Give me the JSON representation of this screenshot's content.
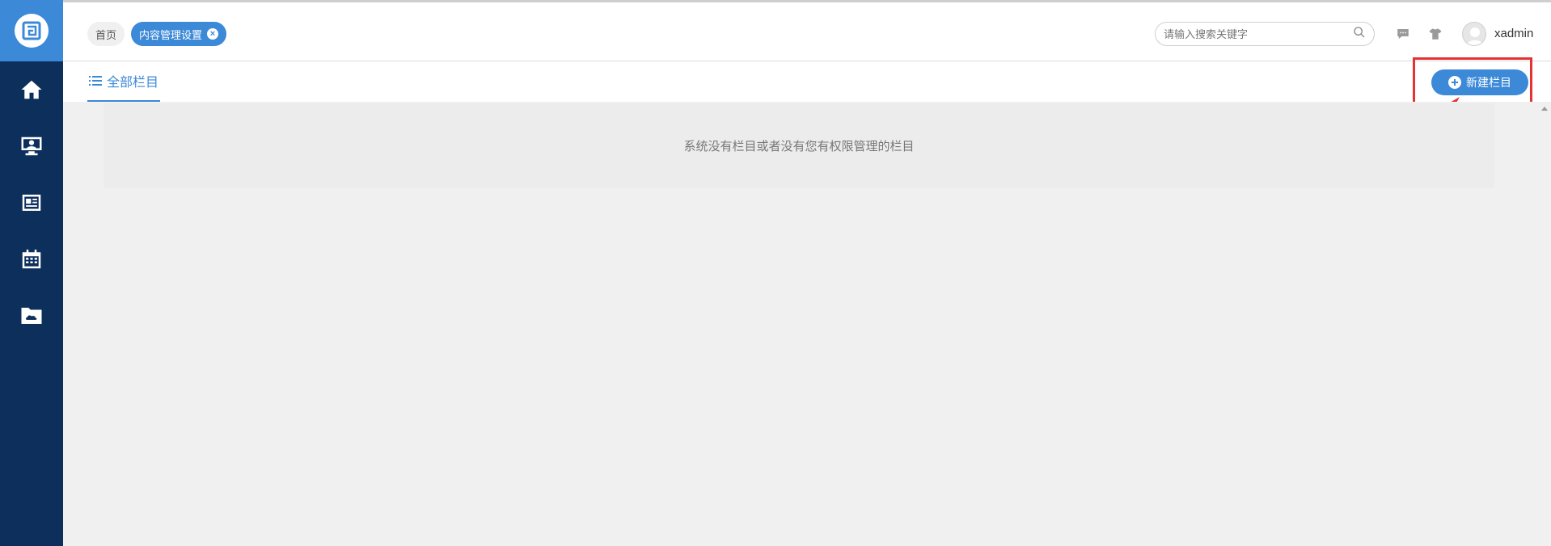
{
  "sidebar": {
    "items": [
      {
        "name": "home",
        "icon": "home-icon"
      },
      {
        "name": "user-monitor",
        "icon": "monitor-user-icon"
      },
      {
        "name": "news",
        "icon": "news-icon"
      },
      {
        "name": "calendar",
        "icon": "calendar-icon"
      },
      {
        "name": "cloud-folder",
        "icon": "cloud-folder-icon"
      }
    ]
  },
  "header": {
    "breadcrumb_home": "首页",
    "breadcrumb_active": "内容管理设置",
    "search_placeholder": "请输入搜索关键字",
    "username": "xadmin"
  },
  "tabs": {
    "all_label": "全部栏目"
  },
  "actions": {
    "new_label": "新建栏目"
  },
  "main": {
    "empty_message": "系统没有栏目或者没有您有权限管理的栏目"
  },
  "colors": {
    "sidebar_bg": "#0d2f5c",
    "accent": "#3c89d8",
    "annotation": "#e63232"
  }
}
